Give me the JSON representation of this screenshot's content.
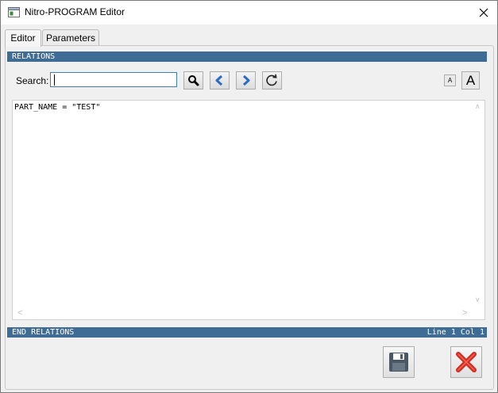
{
  "window": {
    "title": "Nitro-PROGRAM Editor"
  },
  "tabs": [
    {
      "label": "Editor"
    },
    {
      "label": "Parameters"
    }
  ],
  "header_bar": {
    "text": "RELATIONS"
  },
  "search": {
    "label": "Search:",
    "value": "",
    "placeholder": ""
  },
  "toolbar": {
    "font_small_label": "A",
    "font_large_label": "A"
  },
  "editor": {
    "content": "PART_NAME = \"TEST\""
  },
  "footer_bar": {
    "text": "END RELATIONS",
    "position": "Line 1 Col 1"
  },
  "colors": {
    "bar": "#3e6c94",
    "accent": "#3c7fb1",
    "cancel": "#d42a1f"
  },
  "icons": [
    "app-icon",
    "close-icon",
    "search-icon",
    "previous-icon",
    "next-icon",
    "refresh-icon",
    "save-icon",
    "cancel-icon"
  ]
}
